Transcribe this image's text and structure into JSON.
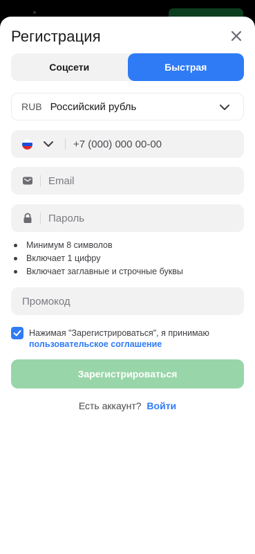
{
  "header": {
    "title": "Регистрация"
  },
  "tabs": [
    {
      "label": "Соцсети",
      "active": false
    },
    {
      "label": "Быстрая",
      "active": true
    }
  ],
  "currency": {
    "code": "RUB",
    "name": "Российский рубль"
  },
  "phone": {
    "country": "Russia",
    "placeholder": "+7 (000) 000 00-00"
  },
  "email": {
    "placeholder": "Email"
  },
  "password": {
    "placeholder": "Пароль",
    "rules": [
      "Минимум 8 символов",
      "Включает 1 цифру",
      "Включает заглавные и строчные буквы"
    ]
  },
  "promo": {
    "placeholder": "Промокод"
  },
  "consent": {
    "checked": true,
    "text": "Нажимая \"Зарегистрироваться\", я принимаю",
    "link": "пользовательское соглашение"
  },
  "submit": {
    "label": "Зарегистрироваться"
  },
  "login": {
    "prompt": "Есть аккаунт?",
    "link": "Войти"
  },
  "colors": {
    "accent": "#2f7bf5",
    "submit_disabled": "#98d5a8",
    "field_bg": "#f2f2f3"
  },
  "icons": {
    "close": "close-icon",
    "chevron": "chevron-down-icon",
    "flag": "russia-flag-icon",
    "email": "envelope-icon",
    "password": "lock-icon",
    "checkbox": "check-icon"
  }
}
